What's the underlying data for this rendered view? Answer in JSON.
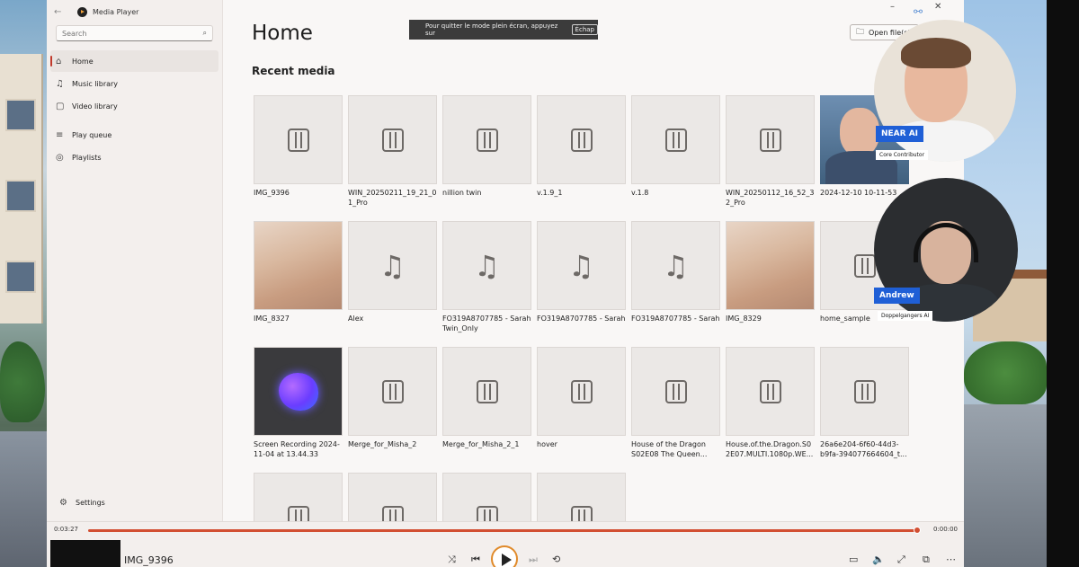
{
  "window": {
    "title": "Media Player"
  },
  "search": {
    "placeholder": "Search"
  },
  "nav": {
    "items": [
      {
        "label": "Home",
        "icon": "home-icon"
      },
      {
        "label": "Music library",
        "icon": "music-icon"
      },
      {
        "label": "Video library",
        "icon": "video-icon"
      },
      {
        "label": "Play queue",
        "icon": "queue-icon"
      },
      {
        "label": "Playlists",
        "icon": "playlist-icon"
      }
    ],
    "settings": "Settings"
  },
  "main": {
    "title": "Home",
    "section": "Recent media",
    "open_file": "Open file(s)"
  },
  "toast": {
    "text": "Pour quitter le mode plein écran, appuyez sur",
    "key": "Échap"
  },
  "tiles": [
    {
      "label": "IMG_9396",
      "kind": "video"
    },
    {
      "label": "WIN_20250211_19_21_01_Pro",
      "kind": "video"
    },
    {
      "label": "nillion twin",
      "kind": "video"
    },
    {
      "label": "v.1.9_1",
      "kind": "video"
    },
    {
      "label": "v.1.8",
      "kind": "video"
    },
    {
      "label": "WIN_20250112_16_52_32_Pro",
      "kind": "video"
    },
    {
      "label": "2024-12-10 10-11-53",
      "kind": "person"
    },
    {
      "label": "IMG_8327",
      "kind": "skin"
    },
    {
      "label": "Alex",
      "kind": "music"
    },
    {
      "label": "FO319A8707785 - Sarah Twin_Only",
      "kind": "music"
    },
    {
      "label": "FO319A8707785 - Sarah",
      "kind": "music"
    },
    {
      "label": "FO319A8707785 - Sarah",
      "kind": "music"
    },
    {
      "label": "IMG_8329",
      "kind": "skin"
    },
    {
      "label": "home_sample",
      "kind": "video"
    },
    {
      "label": "Screen Recording 2024-11-04 at 13.44.33",
      "kind": "blob"
    },
    {
      "label": "Merge_for_Misha_2",
      "kind": "video"
    },
    {
      "label": "Merge_for_Misha_2_1",
      "kind": "video"
    },
    {
      "label": "hover",
      "kind": "video"
    },
    {
      "label": "House of the Dragon S02E08 The Queen...",
      "kind": "video"
    },
    {
      "label": "House.of.the.Dragon.S02E07.MULTI.1080p.WE...",
      "kind": "video"
    },
    {
      "label": "26a6e204-6f60-44d3-b9fa-394077664604_t...",
      "kind": "video"
    },
    {
      "label": "",
      "kind": "video"
    },
    {
      "label": "",
      "kind": "video"
    },
    {
      "label": "",
      "kind": "video"
    },
    {
      "label": "",
      "kind": "video"
    }
  ],
  "player": {
    "elapsed": "0:03:27",
    "remaining": "0:00:00",
    "progress": 1.0,
    "now_playing": "IMG_9396",
    "accent": "#d24f32"
  },
  "call": {
    "participant1": {
      "name": "NEAR AI",
      "role": "Core Contributor"
    },
    "participant2": {
      "name": "Andrew",
      "role": "Doppelgangers AI"
    }
  }
}
